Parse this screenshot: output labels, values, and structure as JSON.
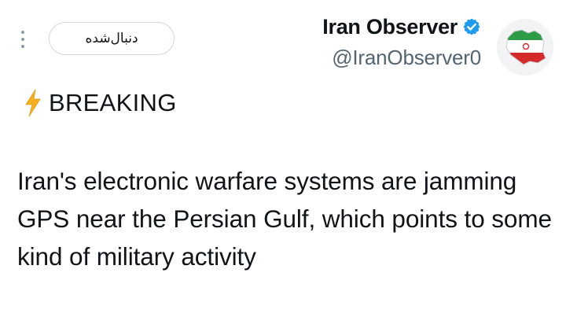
{
  "header": {
    "follow_label": "دنبال‌شده",
    "display_name": "Iran Observer",
    "handle": "@IranObserver0",
    "verified_color": "#1d9bf0"
  },
  "icons": {
    "more": "more-vertical-icon",
    "verified": "verified-badge-icon",
    "bolt": "high-voltage-icon"
  },
  "tweet": {
    "breaking_label": "BREAKING",
    "text": "Iran's electronic warfare systems are jamming GPS near the Persian Gulf, which points to some kind of military activity"
  }
}
